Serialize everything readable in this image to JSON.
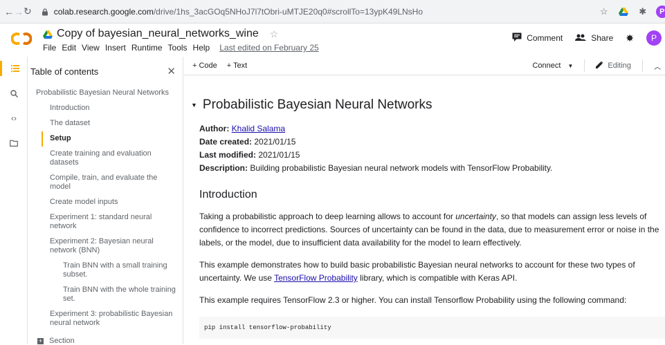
{
  "browser": {
    "url_host": "colab.research.google.com",
    "url_path": "/drive/1hs_3acGOq5NHoJ7l7tObri-uMTJE20q0#scrollTo=13ypK49LNsHo",
    "profile_initial": "P"
  },
  "header": {
    "title": "Copy of bayesian_neural_networks_wine",
    "menu": [
      "File",
      "Edit",
      "View",
      "Insert",
      "Runtime",
      "Tools",
      "Help"
    ],
    "last_edited": "Last edited on February 25",
    "comment_label": "Comment",
    "share_label": "Share",
    "avatar_initial": "P"
  },
  "toc": {
    "title": "Table of contents",
    "items": [
      {
        "label": "Probabilistic Bayesian Neural Networks",
        "level": 1
      },
      {
        "label": "Introduction",
        "level": 2
      },
      {
        "label": "The dataset",
        "level": 2
      },
      {
        "label": "Setup",
        "level": 2,
        "active": true
      },
      {
        "label": "Create training and evaluation datasets",
        "level": 2
      },
      {
        "label": "Compile, train, and evaluate the model",
        "level": 2
      },
      {
        "label": "Create model inputs",
        "level": 2
      },
      {
        "label": "Experiment 1: standard neural network",
        "level": 2
      },
      {
        "label": "Experiment 2: Bayesian neural network (BNN)",
        "level": 2
      },
      {
        "label": "Train BNN with a small training subset.",
        "level": 3
      },
      {
        "label": "Train BNN with the whole training set.",
        "level": 3
      },
      {
        "label": "Experiment 3: probabilistic Bayesian neural network",
        "level": 2
      }
    ],
    "section_label": "Section"
  },
  "toolbar": {
    "code_label": "+ Code",
    "text_label": "+ Text",
    "connect_label": "Connect",
    "editing_label": "Editing"
  },
  "doc": {
    "title": "Probabilistic Bayesian Neural Networks",
    "author_label": "Author:",
    "author_name": "Khalid Salama",
    "created_label": "Date created:",
    "created_value": "2021/01/15",
    "modified_label": "Last modified:",
    "modified_value": "2021/01/15",
    "description_label": "Description:",
    "description_value": "Building probabilistic Bayesian neural network models with TensorFlow Probability.",
    "intro_heading": "Introduction",
    "intro_p1_before": "Taking a probabilistic approach to deep learning allows to account for ",
    "intro_p1_italic": "uncertainty",
    "intro_p1_after": ", so that models can assign less levels of confidence to incorrect predictions. Sources of uncertainty can be found in the data, due to measurement error or noise in the labels, or the model, due to insufficient data availability for the model to learn effectively.",
    "intro_p2_before": "This example demonstrates how to build basic probabilistic Bayesian neural networks to account for these two types of uncertainty. We use ",
    "intro_p2_link": "TensorFlow Probability",
    "intro_p2_after": " library, which is compatible with Keras API.",
    "intro_p3": "This example requires TensorFlow 2.3 or higher. You can install Tensorflow Probability using the following command:",
    "code": "pip install tensorflow-probability"
  },
  "colors": {
    "accent": "#f9ab00",
    "link": "#1a0dab",
    "avatar": "#a142f4"
  }
}
